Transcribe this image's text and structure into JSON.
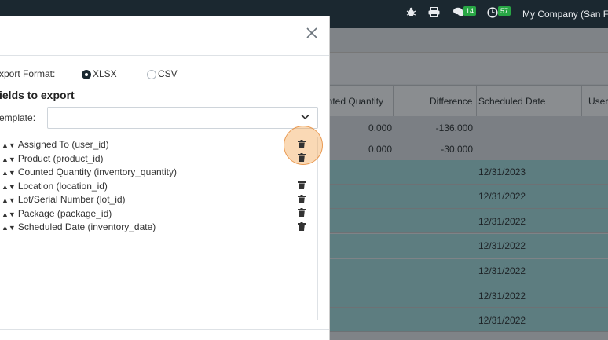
{
  "topbar": {
    "messages_badge": "14",
    "activities_badge": "57",
    "company": "My Company (San Fra"
  },
  "table": {
    "columns": [
      "unted Quantity",
      "Difference",
      "Scheduled Date",
      "User"
    ],
    "rows": [
      {
        "counted": "0.000",
        "difference": "-136.000",
        "date": ""
      },
      {
        "counted": "0.000",
        "difference": "-30.000",
        "date": ""
      },
      {
        "counted": "",
        "difference": "",
        "date": "12/31/2023"
      },
      {
        "counted": "",
        "difference": "",
        "date": "12/31/2022"
      },
      {
        "counted": "",
        "difference": "",
        "date": "12/31/2022"
      },
      {
        "counted": "",
        "difference": "",
        "date": "12/31/2022"
      },
      {
        "counted": "",
        "difference": "",
        "date": "12/31/2022"
      },
      {
        "counted": "",
        "difference": "",
        "date": "12/31/2022"
      },
      {
        "counted": "",
        "difference": "",
        "date": "12/31/2022"
      }
    ]
  },
  "modal": {
    "export_format_label": "xport Format:",
    "format_xlsx": "XLSX",
    "format_csv": "CSV",
    "fields_heading": "ields to export",
    "template_label": "emplate:",
    "template_value": "",
    "fields": [
      "Assigned To (user_id)",
      "Product (product_id)",
      "Counted Quantity (inventory_quantity)",
      "Location (location_id)",
      "Lot/Serial Number (lot_id)",
      "Package (package_id)",
      "Scheduled Date (inventory_date)"
    ]
  }
}
